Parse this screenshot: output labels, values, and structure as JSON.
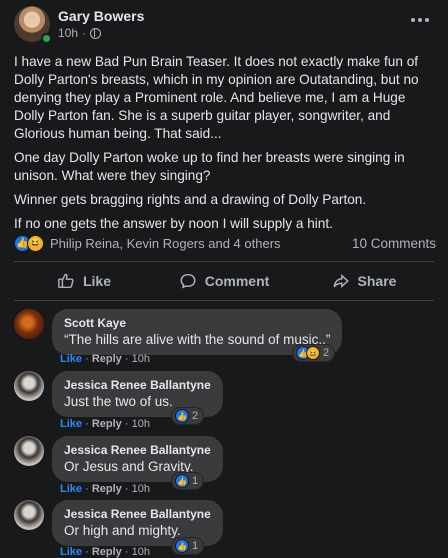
{
  "post": {
    "author": "Gary Bowers",
    "time": "10h",
    "privacy_sep": "·",
    "paragraphs": [
      "I have a new Bad Pun Brain Teaser. It does not exactly make fun of Dolly Parton's breasts, which in my opinion are Outatanding, but no denying they play a Prominent role. And believe me, I am a Huge Dolly Parton fan. She is a superb guitar player, songwriter, and Glorious human being. That said...",
      "One day Dolly Parton woke up to find her breasts were singing in unison. What were they singing?",
      "Winner gets bragging rights and a drawing of Dolly Parton.",
      "If no one gets the answer by noon I will supply a hint."
    ],
    "reactors": "Philip Reina, Kevin Rogers and 4 others",
    "comments_count": "10 Comments"
  },
  "actions": {
    "like": "Like",
    "comment": "Comment",
    "share": "Share"
  },
  "comments": [
    {
      "name": "Scott Kaye",
      "text": "“The hills are alive with the sound of music..”",
      "like": "Like",
      "sep": "·",
      "reply": "Reply",
      "time": "10h",
      "reaction_count": "2"
    },
    {
      "name": "Jessica Renee Ballantyne",
      "text": "Just the two of us.",
      "like": "Like",
      "sep": "·",
      "reply": "Reply",
      "time": "10h",
      "reaction_count": "2"
    },
    {
      "name": "Jessica Renee Ballantyne",
      "text": "Or Jesus and Gravity.",
      "like": "Like",
      "sep": "·",
      "reply": "Reply",
      "time": "10h",
      "reaction_count": "1"
    },
    {
      "name": "Jessica Renee Ballantyne",
      "text": "Or high and mighty.",
      "like": "Like",
      "sep": "·",
      "reply": "Reply",
      "time": "10h",
      "reaction_count": "1"
    }
  ],
  "icons": {
    "like": "like-icon",
    "haha": "haha-icon",
    "globe": "globe-icon",
    "more": "more-icon",
    "comment": "comment-icon",
    "share": "share-icon"
  },
  "colors": {
    "background": "#18191a",
    "bubble": "#3a3b3c",
    "accent": "#1877f2",
    "link": "#2d88ff",
    "muted": "#b0b3b8"
  }
}
